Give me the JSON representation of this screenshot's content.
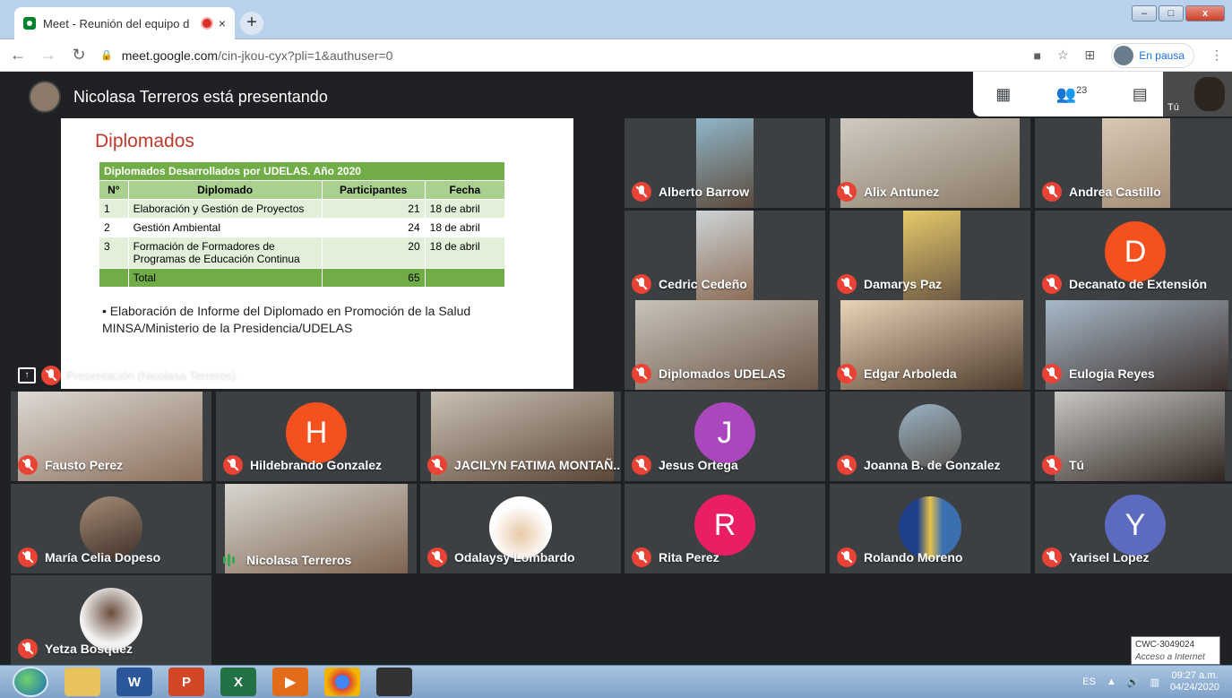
{
  "browser": {
    "tab_title": "Meet - Reunión del equipo d",
    "tab_close": "×",
    "new_tab": "+",
    "url_host": "meet.google.com",
    "url_path": "/cin-jkou-cyx?pli=1&authuser=0",
    "profile_status": "En pausa",
    "window_buttons": [
      "–",
      "□",
      "x"
    ]
  },
  "meet": {
    "presenter_text": "Nicolasa Terreros está presentando",
    "participant_count": "23",
    "self_label": "Tú",
    "presentation_label": "Presentación (Nicolasa Terreros)"
  },
  "slide": {
    "title": "Diplomados",
    "table_caption": "Diplomados Desarrollados por UDELAS. Año 2020",
    "headers": [
      "N°",
      "Diplomado",
      "Participantes",
      "Fecha"
    ],
    "rows": [
      [
        "1",
        "Elaboración y Gestión de Proyectos",
        "21",
        "18 de abril"
      ],
      [
        "2",
        "Gestión Ambiental",
        "24",
        "18 de abril"
      ],
      [
        "3",
        "Formación de Formadores de Programas de Educación Continua",
        "20",
        "18 de abril"
      ]
    ],
    "total_label": "Total",
    "total_value": "65",
    "bullet": "•  Elaboración de Informe del Diplomado en Promoción de la Salud MINSA/Ministerio de la Presidencia/UDELAS"
  },
  "participants": [
    {
      "name": "Alberto Barrow"
    },
    {
      "name": "Alix Antunez"
    },
    {
      "name": "Andrea Castillo"
    },
    {
      "name": "Cedric Cedeño"
    },
    {
      "name": "Damarys Paz"
    },
    {
      "name": "Decanato de Extensión",
      "initial": "D"
    },
    {
      "name": "Diplomados UDELAS"
    },
    {
      "name": "Edgar Arboleda"
    },
    {
      "name": "Eulogia Reyes"
    },
    {
      "name": "Fausto Perez"
    },
    {
      "name": "Hildebrando Gonzalez",
      "initial": "H"
    },
    {
      "name": "JACILYN FATIMA MONTAÑ..."
    },
    {
      "name": "Jesus Ortega",
      "initial": "J"
    },
    {
      "name": "Joanna B. de Gonzalez"
    },
    {
      "name": "Tú"
    },
    {
      "name": "María Celia Dopeso"
    },
    {
      "name": "Nicolasa Terreros"
    },
    {
      "name": "Odalaysy Lombardo"
    },
    {
      "name": "Rita Perez",
      "initial": "R"
    },
    {
      "name": "Rolando Moreno"
    },
    {
      "name": "Yarisel Lopez",
      "initial": "Y"
    },
    {
      "name": "Yetza Bosquez"
    }
  ],
  "colors": {
    "muted_mic": "#ea4335",
    "speaking": "#34a853",
    "D": "#f4511e",
    "H": "#f4511e",
    "J": "#ab47bc",
    "R": "#e91e63",
    "Y": "#5c6bc0"
  },
  "taskbar": {
    "lang": "ES",
    "time": "09:27 a.m.",
    "date": "04/24/2020"
  },
  "tooltip": {
    "line1": "CWC-3049024",
    "line2": "Acceso a Internet"
  }
}
